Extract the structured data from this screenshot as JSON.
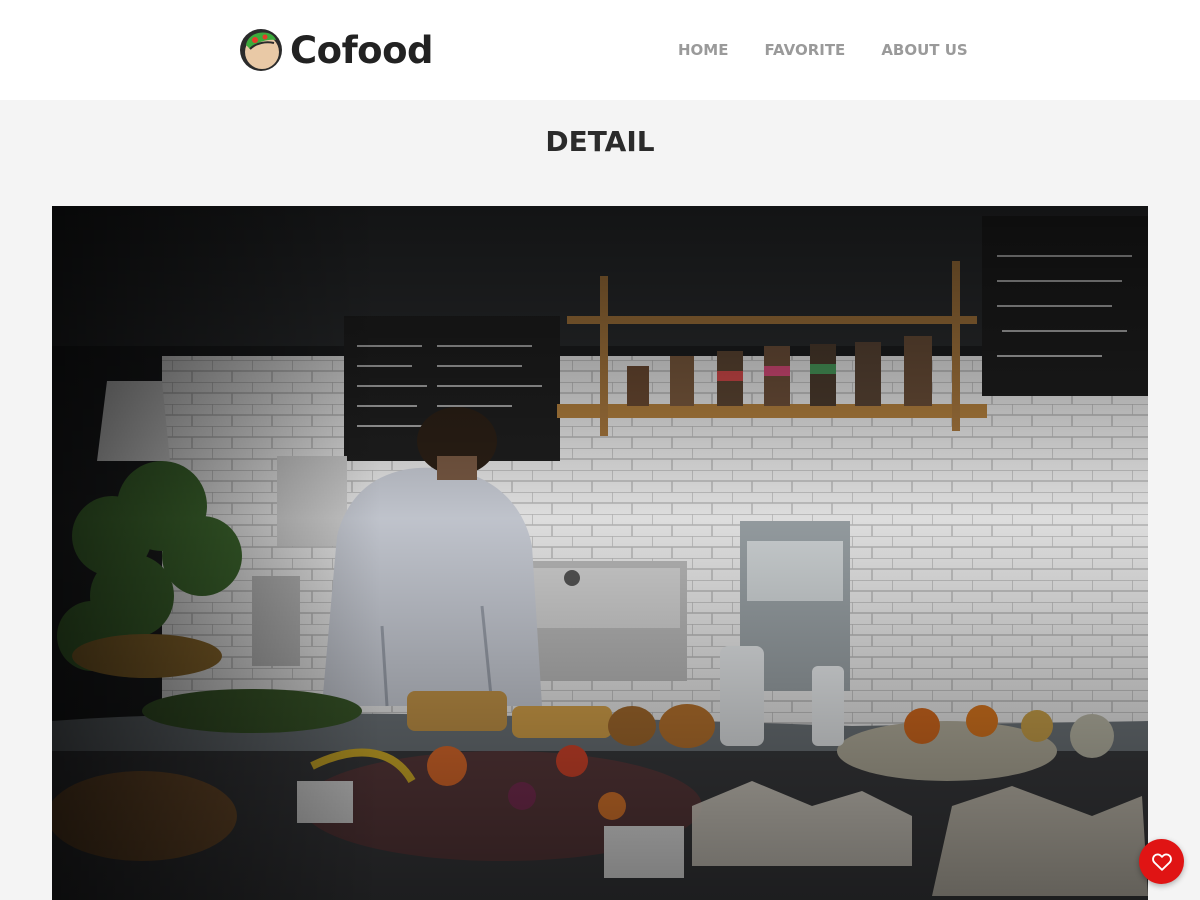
{
  "header": {
    "brand": "Cofood",
    "nav": [
      {
        "label": "HOME"
      },
      {
        "label": "FAVORITE"
      },
      {
        "label": "ABOUT US"
      }
    ]
  },
  "main": {
    "title": "DETAIL",
    "image": {
      "subject": "restaurant kitchen counter photo"
    }
  },
  "fab": {
    "icon": "heart-icon"
  },
  "colors": {
    "accent": "#e01414",
    "nav_text": "#9a9a9a",
    "title_text": "#2b2b2b",
    "background": "#f4f4f4"
  }
}
